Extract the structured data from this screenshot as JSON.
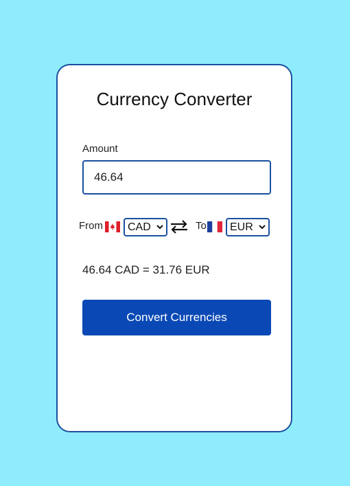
{
  "app": {
    "title": "Currency Converter"
  },
  "amount": {
    "label": "Amount",
    "value": "46.64"
  },
  "from": {
    "label": "From",
    "currency": "CAD",
    "flag": "canada-flag-icon"
  },
  "to": {
    "label": "To",
    "currency": "EUR",
    "flag": "france-flag-icon"
  },
  "swap": {
    "icon": "swap-arrows-icon"
  },
  "result": {
    "text": "46.64 CAD = 31.76 EUR"
  },
  "convert_button": {
    "label": "Convert Currencies"
  },
  "colors": {
    "page_background": "#8fecfc",
    "card_background": "#ffffff",
    "accent_border": "#1a4fa0",
    "button_background": "#0a49b5",
    "button_text": "#ffffff"
  }
}
